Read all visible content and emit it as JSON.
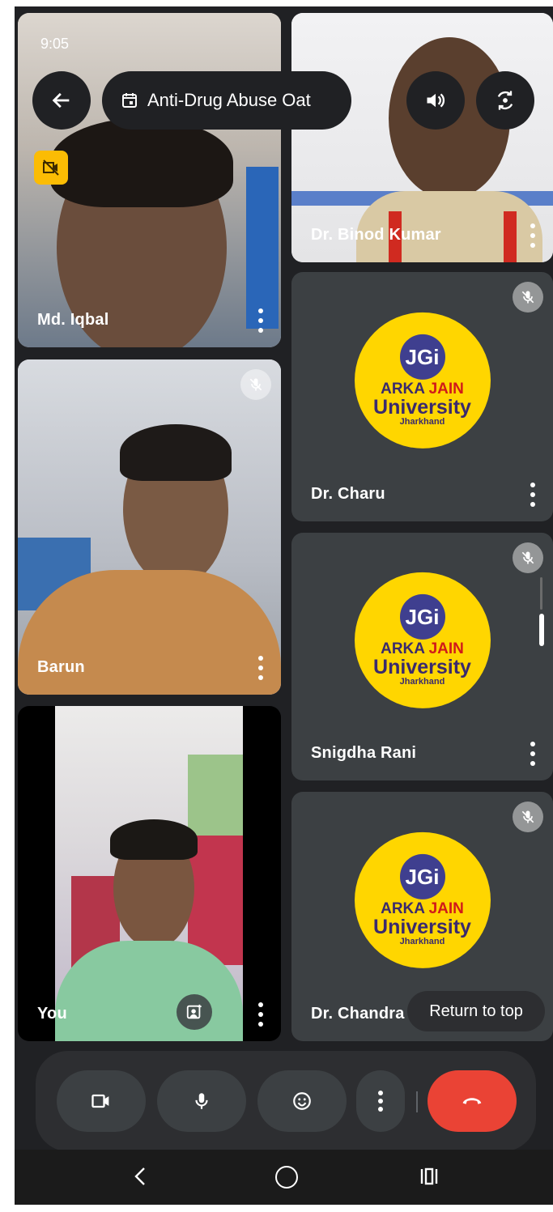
{
  "status_bar": {
    "time": "9:05"
  },
  "header": {
    "meeting_title": "Anti-Drug Abuse Oat"
  },
  "participants": [
    {
      "name": "Md. Iqbal"
    },
    {
      "name": "Dr. Binod Kumar"
    },
    {
      "name": "Barun"
    },
    {
      "name": "Dr. Charu"
    },
    {
      "name": "Snigdha Rani"
    },
    {
      "name": "You"
    },
    {
      "name": "Dr. Chandra"
    }
  ],
  "logo": {
    "badge": "JGi",
    "line1_a": "ARKA",
    "line1_b": "JAIN",
    "line2": "University",
    "line3": "Jharkhand"
  },
  "return_to_top": "Return to top",
  "colors": {
    "background": "#202124",
    "tile": "#3c4043",
    "end_call": "#ea4335",
    "camera_off_badge": "#fbbc04",
    "logo_yellow": "#ffd600"
  }
}
